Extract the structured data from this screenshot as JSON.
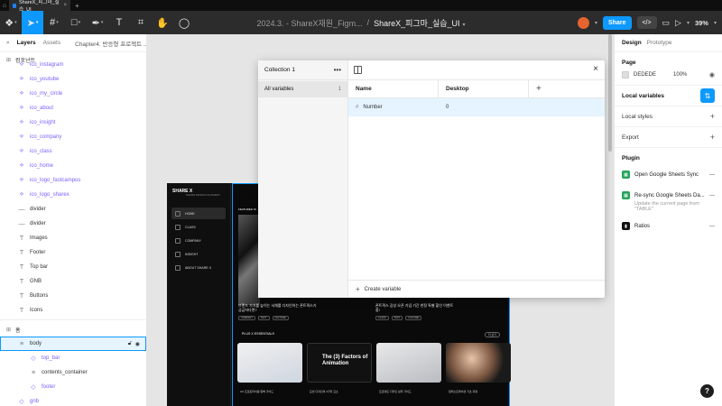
{
  "browser": {
    "tab_title": "ShareX_피그마_실습_UI"
  },
  "toolbar": {
    "team": "2024.3. - ShareX재원_Figm...",
    "separator": "/",
    "file_name": "ShareX_피그마_실습_UI",
    "share_label": "Share",
    "zoom": "39%"
  },
  "left_panel": {
    "tab_layers": "Layers",
    "tab_assets": "Assets",
    "page_name": "Chapter4. 반응형 프로젝트 ...",
    "section_components": "컴포넌트",
    "components": [
      "ico_instagram",
      "ico_youtube",
      "ico_my_circle",
      "ico_about",
      "ico_insight",
      "ico_company",
      "ico_class",
      "ico_home",
      "ico_logo_fastcampus",
      "ico_logo_sharex"
    ],
    "frames": [
      "divider",
      "divider",
      "Images",
      "Footer",
      "Top bar",
      "GNB",
      "Buttons",
      "Icons"
    ],
    "section_home": "홈",
    "selected_layer": "body",
    "children": [
      "top_bar",
      "contents_container",
      "footer"
    ],
    "last_layer": "gnb"
  },
  "canvas": {
    "site": {
      "brand": "SHARE X",
      "brand_sub": "SHARE DESIGN ACADEMY",
      "nav": [
        "HOME",
        "CLASS",
        "COMPANY",
        "INSIGHT",
        "ABOUT SHARE X"
      ],
      "featured": "FEATURED IN",
      "text1": "브랜드 가치를 높이는 서체를 디자인하는 폰트픽스가 궁금하다면?",
      "chips1": [
        "COMPANY",
        "TEXT",
        "CULTURE"
      ],
      "text2": "폰트픽스 감성 오픈 기념 기간 한정 특별 할인 이벤트 중!",
      "chips2": [
        "CLASS",
        "TEXT",
        "CULTURE"
      ],
      "plus_title": "PLUS X ESSENTIALS",
      "more": "더 보기",
      "card2_title": "The (3) Factors of Animation",
      "captions": [
        "UX 프로토타이핑 완벽 가이드",
        "모션 디자인의 3가지 요소",
        "프로덕트 디자인 실무 가이드",
        "일러스트레이션 기초 과정"
      ]
    }
  },
  "modal": {
    "collection_name": "Collection 1",
    "all_variables_label": "All variables",
    "all_variables_count": "1",
    "col_name": "Name",
    "col_mode": "Desktop",
    "variables": [
      {
        "name": "Number",
        "value": "0"
      }
    ],
    "create_label": "Create variable"
  },
  "right_panel": {
    "tab_design": "Design",
    "tab_prototype": "Prototype",
    "page_title": "Page",
    "page_color": "DEDEDE",
    "page_opacity": "100%",
    "local_variables": "Local variables",
    "local_styles": "Local styles",
    "export": "Export",
    "plugin_title": "Plugin",
    "plugins": [
      {
        "name": "Open Google Sheets Sync"
      },
      {
        "name": "Re-sync Google Sheets Da...",
        "sub": "Update the current page from \"TABLE\""
      },
      {
        "name": "Ratios"
      }
    ]
  },
  "colors": {
    "accent": "#0d99ff",
    "toolbar_bg": "#2c2c2c",
    "canvas_bg": "#e5e5e5",
    "component_purple": "#7b61ff"
  }
}
